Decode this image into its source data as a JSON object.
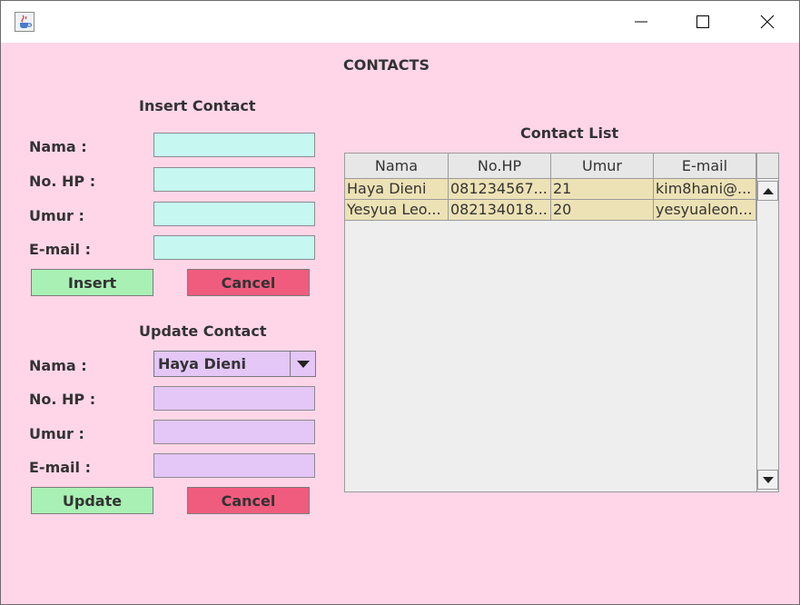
{
  "window": {
    "icon": "java-cup-icon",
    "controls": {
      "minimize": "minimize-icon",
      "maximize": "maximize-icon",
      "close": "close-icon"
    }
  },
  "form": {
    "title": "CONTACTS",
    "insert": {
      "title": "Insert Contact",
      "labels": {
        "nama": "Nama :",
        "hp": "No. HP :",
        "umur": "Umur :",
        "email": "E-mail :"
      },
      "values": {
        "nama": "",
        "hp": "",
        "umur": "",
        "email": ""
      },
      "insert_button": "Insert",
      "cancel_button": "Cancel"
    },
    "update": {
      "title": "Update Contact",
      "labels": {
        "nama": "Nama :",
        "hp": "No. HP :",
        "umur": "Umur :",
        "email": "E-mail :"
      },
      "selected_nama": "Haya Dieni",
      "values": {
        "hp": "",
        "umur": "",
        "email": ""
      },
      "update_button": "Update",
      "cancel_button": "Cancel"
    }
  },
  "list": {
    "title": "Contact List",
    "columns": [
      "Nama",
      "No.HP",
      "Umur",
      "E-mail"
    ],
    "rows": [
      [
        "Haya Dieni",
        "081234567...",
        "21",
        "kim8hani@..."
      ],
      [
        "Yesyua Leo...",
        "082134018...",
        "20",
        "yesyualeon..."
      ]
    ]
  },
  "colors": {
    "background": "#ffd6e8",
    "insert_fields": "#c6f7f1",
    "update_fields": "#e4c6f7",
    "green_button": "#a9f0b4",
    "red_button": "#f05c7e",
    "row_highlight": "#ede2b5"
  }
}
